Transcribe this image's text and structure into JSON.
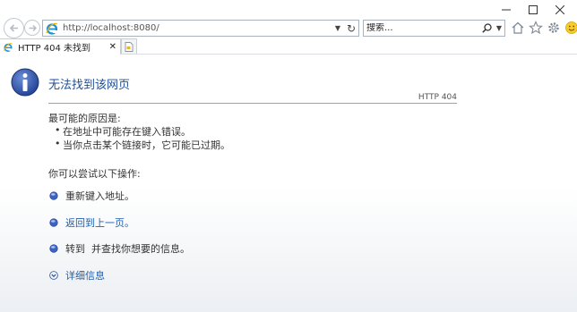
{
  "browser": {
    "address": {
      "url": "http://localhost:8080/"
    },
    "search": {
      "placeholder": "搜索..."
    },
    "tab": {
      "title": "HTTP 404 未找到"
    }
  },
  "content": {
    "title": "无法找到该网页",
    "http_code": "HTTP 404",
    "reasons_heading": "最可能的原因是:",
    "reasons": [
      "在地址中可能存在键入错误。",
      "当你点击某个链接时，它可能已过期。"
    ],
    "try_heading": "你可以尝试以下操作:",
    "actions": [
      {
        "label": "重新键入地址。",
        "link": false
      },
      {
        "label": "返回到上一页。",
        "link": true
      },
      {
        "label": "转到  并查找你想要的信息。",
        "link": false
      },
      {
        "label": "详细信息",
        "link": true
      }
    ]
  }
}
